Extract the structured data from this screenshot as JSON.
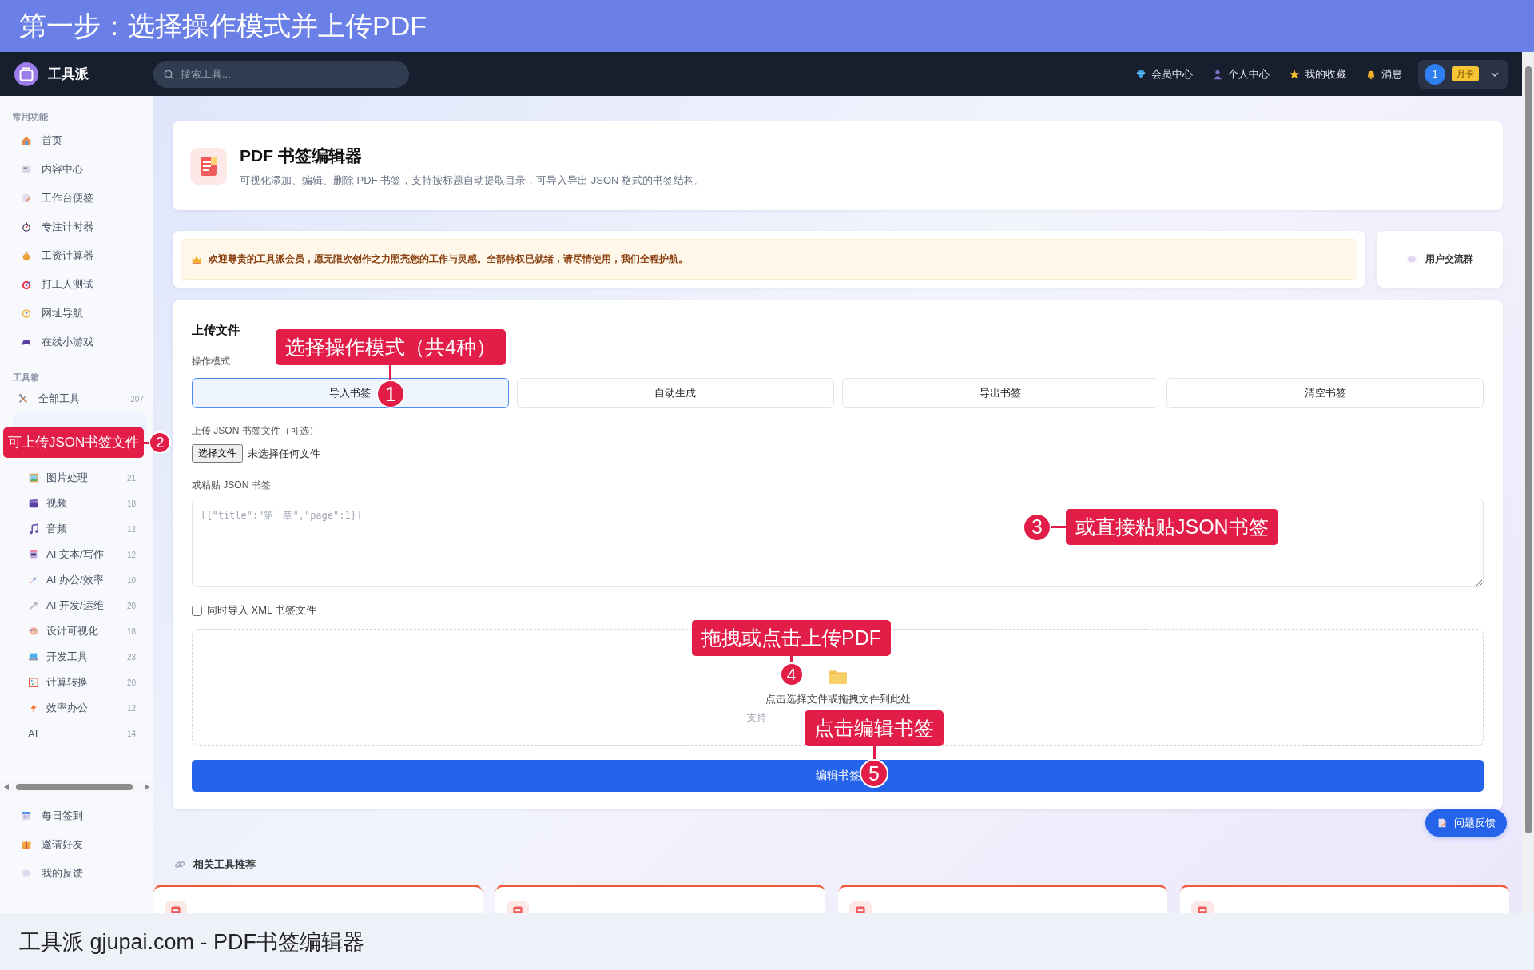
{
  "banner": {
    "title": "第一步：选择操作模式并上传PDF"
  },
  "navbar": {
    "brand": "工具派",
    "search": {
      "placeholder": "搜索工具..."
    },
    "links": [
      "会员中心",
      "个人中心",
      "我的收藏",
      "消息"
    ],
    "user": {
      "avatar": "1",
      "badge": "月卡"
    }
  },
  "sidebar": {
    "sections": [
      {
        "heading": "常用功能",
        "items": [
          {
            "label": "首页"
          },
          {
            "label": "内容中心"
          },
          {
            "label": "工作台便签"
          },
          {
            "label": "专注计时器"
          },
          {
            "label": "工资计算器"
          },
          {
            "label": "打工人测试"
          },
          {
            "label": "网址导航"
          },
          {
            "label": "在线小游戏"
          }
        ]
      },
      {
        "heading": "工具箱",
        "items": [
          {
            "label": "全部工具",
            "count": "207"
          },
          {
            "label": "图片处理",
            "count": "21"
          },
          {
            "label": "视频",
            "count": "18"
          },
          {
            "label": "音频",
            "count": "12"
          },
          {
            "label": "AI 文本/写作",
            "count": "12"
          },
          {
            "label": "AI 办公/效率",
            "count": "10"
          },
          {
            "label": "AI 开发/运维",
            "count": "20"
          },
          {
            "label": "设计可视化",
            "count": "18"
          },
          {
            "label": "开发工具",
            "count": "23"
          },
          {
            "label": "计算转换",
            "count": "20"
          },
          {
            "label": "效率办公",
            "count": "12"
          },
          {
            "label": "AI",
            "count": "14"
          }
        ]
      }
    ],
    "footer_items": [
      {
        "label": "每日签到"
      },
      {
        "label": "邀请好友"
      },
      {
        "label": "我的反馈"
      }
    ]
  },
  "tool_header": {
    "title": "PDF 书签编辑器",
    "description": "可视化添加、编辑、删除 PDF 书签，支持按标题自动提取目录，可导入导出 JSON 格式的书签结构。"
  },
  "welcome": {
    "message": "欢迎尊贵的工具派会员，愿无限次创作之力照亮您的工作与灵感。全部特权已就绪，请尽情使用，我们全程护航。",
    "group_button": "用户交流群"
  },
  "upload": {
    "title": "上传文件",
    "mode_label": "操作模式",
    "modes": [
      {
        "label": "导入书签",
        "selected": true
      },
      {
        "label": "自动生成",
        "selected": false
      },
      {
        "label": "导出书签",
        "selected": false
      },
      {
        "label": "清空书签",
        "selected": false
      }
    ],
    "json_file_label": "上传 JSON 书签文件（可选）",
    "file_button": "选择文件",
    "file_status": "未选择任何文件",
    "paste_label": "或粘贴 JSON 书签",
    "paste_placeholder": "[{\"title\":\"第一章\",\"page\":1}]",
    "xml_option": {
      "label": "同时导入 XML 书签文件",
      "checked": false
    },
    "dropzone": {
      "text": "点击选择文件或拖拽文件到此处",
      "hint": "支持"
    },
    "submit": "编辑书签"
  },
  "feedback_button": "问题反馈",
  "related": {
    "title": "相关工具推荐",
    "cards": [
      {
        "kind": "tool-card"
      },
      {
        "kind": "tool-card"
      },
      {
        "kind": "tool-card"
      },
      {
        "kind": "tool-card"
      }
    ]
  },
  "annotations": [
    {
      "number": "1",
      "text": "选择操作模式（共4种）"
    },
    {
      "number": "2",
      "text": "可上传JSON书签文件"
    },
    {
      "number": "3",
      "text": "或直接粘贴JSON书签"
    },
    {
      "number": "4",
      "text": "拖拽或点击上传PDF"
    },
    {
      "number": "5",
      "text": "点击编辑书签"
    }
  ],
  "caption": "工具派 gjupai.com - PDF书签编辑器"
}
